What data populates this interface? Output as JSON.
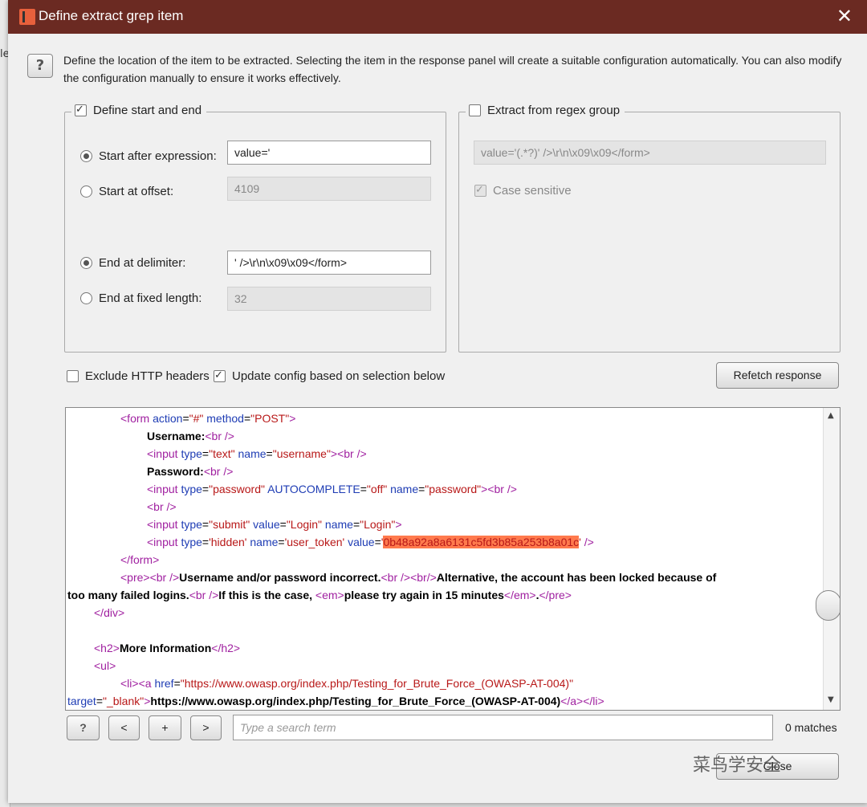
{
  "window": {
    "title": "Define extract grep item",
    "close_label": "✕"
  },
  "help_label": "?",
  "intro": "Define the location of the item to be extracted. Selecting the item in the response panel will create a suitable configuration automatically. You can also modify the configuration manually to ensure it works effectively.",
  "start_end": {
    "title": "Define start and end",
    "checked": true,
    "start_after_label": "Start after expression:",
    "start_after_value": "value='",
    "start_offset_label": "Start at offset:",
    "start_offset_value": "4109",
    "end_delim_label": "End at delimiter:",
    "end_delim_value": "' />\\r\\n\\x09\\x09</form>",
    "end_fixed_label": "End at fixed length:",
    "end_fixed_value": "32"
  },
  "regex": {
    "title": "Extract from regex group",
    "checked": false,
    "pattern": "value='(.*?)' />\\r\\n\\x09\\x09</form>",
    "case_sensitive_label": "Case sensitive"
  },
  "options": {
    "exclude_headers_label": "Exclude HTTP headers",
    "update_config_label": "Update config based on selection below",
    "refetch_label": "Refetch response"
  },
  "code": {
    "form_open": "action=\"#\" method=\"POST\"",
    "username_label": "Username:",
    "password_label": "Password:",
    "token": "0b48a92a8a6131c5fd3b85a253b8a01c",
    "error_line1": "Username and/or password incorrect.",
    "error_line1b": "Alternative, the account has been locked because of",
    "error_line2": "too many failed logins.",
    "error_line2b": "If this is the case, ",
    "error_em": "please try again in 15 minutes",
    "more_info": "More Information",
    "href": "https://www.owasp.org/index.php/Testing_for_Brute_Force_(OWASP-AT-004)",
    "link_text": "https://www.owasp.org/index.php/Testing_for_Brute_Force_(OWASP-AT-004)"
  },
  "search": {
    "help": "?",
    "prev": "<",
    "add": "+",
    "next": ">",
    "placeholder": "Type a search term",
    "matches": "0 matches"
  },
  "footer": {
    "close_label": "Close"
  },
  "watermark": "菜鸟学安全"
}
